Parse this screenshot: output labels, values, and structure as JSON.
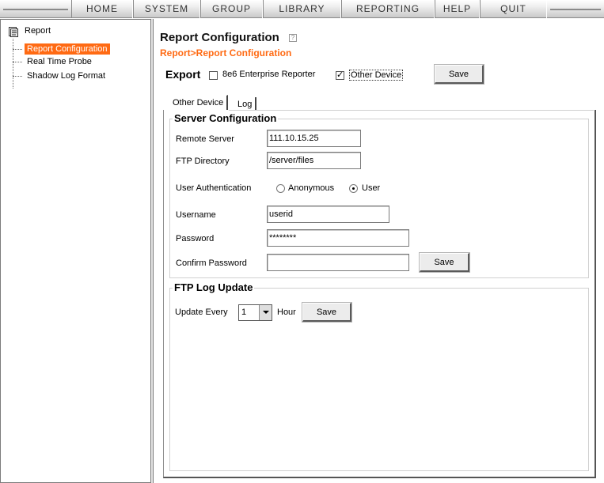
{
  "menu": {
    "items": [
      {
        "id": "home",
        "label": "HOME"
      },
      {
        "id": "system",
        "label": "SYSTEM"
      },
      {
        "id": "group",
        "label": "GROUP"
      },
      {
        "id": "library",
        "label": "LIBRARY"
      },
      {
        "id": "reporting",
        "label": "REPORTING"
      },
      {
        "id": "help",
        "label": "HELP"
      },
      {
        "id": "quit",
        "label": "QUIT"
      }
    ]
  },
  "sidebar": {
    "root_label": "Report",
    "items": [
      {
        "label": "Report Configuration",
        "selected": true
      },
      {
        "label": "Real Time Probe",
        "selected": false
      },
      {
        "label": "Shadow Log Format",
        "selected": false
      }
    ]
  },
  "page": {
    "title": "Report Configuration",
    "breadcrumb": "Report>Report Configuration",
    "help_icon": "help-icon"
  },
  "export": {
    "label": "Export",
    "options": [
      {
        "label": "8e6 Enterprise Reporter",
        "checked": false
      },
      {
        "label": "Other Device",
        "checked": true
      }
    ],
    "save_label": "Save"
  },
  "tabs": [
    {
      "label": "Other Device",
      "active": true
    },
    {
      "label": "Log",
      "active": false
    }
  ],
  "server_config": {
    "legend": "Server Configuration",
    "remote_server": {
      "label": "Remote Server",
      "value": "111.10.15.25"
    },
    "ftp_directory": {
      "label": "FTP Directory",
      "value": "/server/files"
    },
    "user_auth": {
      "label": "User Authentication",
      "options": [
        {
          "label": "Anonymous",
          "selected": false
        },
        {
          "label": "User",
          "selected": true
        }
      ]
    },
    "username": {
      "label": "Username",
      "value": "userid"
    },
    "password": {
      "label": "Password",
      "value": "********"
    },
    "confirm_password": {
      "label": "Confirm Password",
      "value": ""
    },
    "save_label": "Save"
  },
  "ftp_log_update": {
    "legend": "FTP Log Update",
    "update_every_label": "Update Every",
    "hour_value": "1",
    "hour_label": "Hour",
    "save_label": "Save"
  }
}
